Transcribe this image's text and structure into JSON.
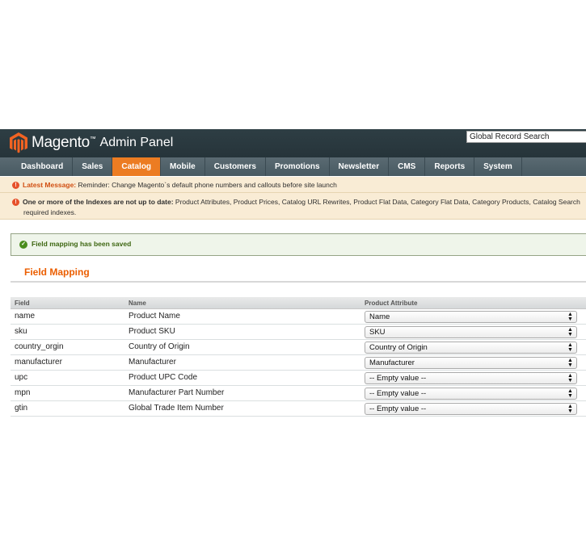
{
  "header": {
    "logo_text": "Magento",
    "logo_sub": "Admin Panel",
    "search_value": "Global Record Search"
  },
  "nav": {
    "items": [
      "Dashboard",
      "Sales",
      "Catalog",
      "Mobile",
      "Customers",
      "Promotions",
      "Newsletter",
      "CMS",
      "Reports",
      "System"
    ],
    "active": "Catalog"
  },
  "messages": {
    "latest_title": "Latest Message:",
    "latest_text": " Reminder: Change Magento`s default phone numbers and callouts before site launch",
    "index_title": "One or more of the Indexes are not up to date:",
    "index_text": " Product Attributes, Product Prices, Catalog URL Rewrites, Product Flat Data, Category Flat Data, Category Products, Catalog Search",
    "index_text2": "required indexes."
  },
  "success": "Field mapping has been saved",
  "page_title": "Field Mapping",
  "grid": {
    "headers": [
      "Field",
      "Name",
      "Product Attribute"
    ],
    "rows": [
      {
        "field": "name",
        "name": "Product Name",
        "attribute": "Name"
      },
      {
        "field": "sku",
        "name": "Product SKU",
        "attribute": "SKU"
      },
      {
        "field": "country_orgin",
        "name": "Country of Origin",
        "attribute": "Country of Origin"
      },
      {
        "field": "manufacturer",
        "name": "Manufacturer",
        "attribute": "Manufacturer"
      },
      {
        "field": "upc",
        "name": "Product UPC Code",
        "attribute": "-- Empty value --"
      },
      {
        "field": "mpn",
        "name": "Manufacturer Part Number",
        "attribute": "-- Empty value --"
      },
      {
        "field": "gtin",
        "name": "Global Trade Item Number",
        "attribute": "-- Empty value --"
      }
    ]
  },
  "colors": {
    "accent": "#ec7c22",
    "header_bg": "#2e3e44",
    "title": "#eb5e00"
  }
}
